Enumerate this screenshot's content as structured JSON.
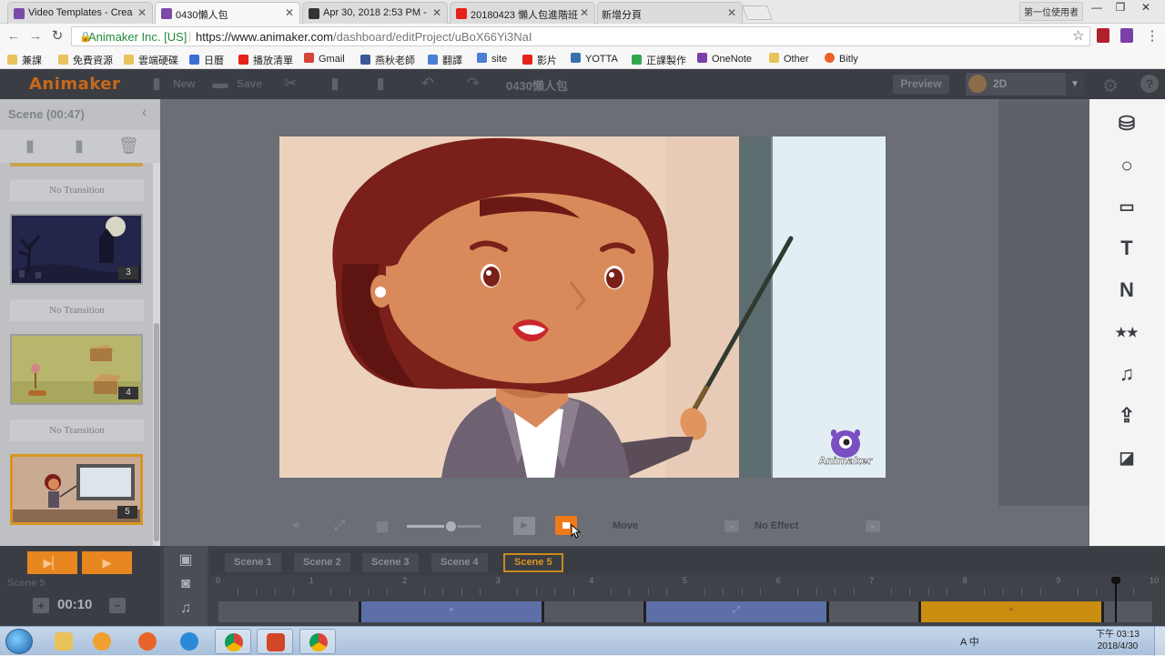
{
  "browser": {
    "tabs": [
      {
        "title": "Video Templates - Crea",
        "icon_color": "#7a4aa8"
      },
      {
        "title": "0430懶人包",
        "icon_color": "#7a4aa8"
      },
      {
        "title": "Apr 30, 2018 2:53 PM -",
        "icon_color": "#333333"
      },
      {
        "title": "20180423 懶人包進階班",
        "icon_color": "#e62117"
      },
      {
        "title": "新增分頁",
        "icon_color": "#cccccc"
      }
    ],
    "user_badge": "第一位使用者",
    "window_buttons": [
      "—",
      "❐",
      "✕"
    ],
    "address": {
      "secure_label": "Animaker Inc. [US]",
      "separator": "|",
      "url_host": "https://www.animaker.com",
      "url_path": "/dashboard/editProject/uBoX66Yi3NaI"
    },
    "bookmarks": [
      {
        "label": "兼課",
        "color": "#e8c35a"
      },
      {
        "label": "免費資源",
        "color": "#e8c35a"
      },
      {
        "label": "雲端硬碟",
        "color": "#e8c35a"
      },
      {
        "label": "日曆",
        "color": "#3b6fd6"
      },
      {
        "label": "播放清單",
        "color": "#e62117"
      },
      {
        "label": "Gmail",
        "color": "#d44638"
      },
      {
        "label": "燕秋老師",
        "color": "#3b5998"
      },
      {
        "label": "翻譯",
        "color": "#4a7fd4"
      },
      {
        "label": "site",
        "color": "#4a7fd4"
      },
      {
        "label": "影片",
        "color": "#e62117"
      },
      {
        "label": "YOTTA",
        "color": "#3a6fb0"
      },
      {
        "label": "正課製作",
        "color": "#2fa84f"
      },
      {
        "label": "OneNote",
        "color": "#7a3fa8"
      },
      {
        "label": "Other",
        "color": "#e8c35a"
      },
      {
        "label": "Bitly",
        "color": "#ee6123"
      }
    ]
  },
  "app": {
    "logo": "Animaker",
    "toolbar": {
      "new_label": "New",
      "save_label": "Save",
      "project_title": "0430懶人包",
      "preview_label": "Preview",
      "mode_label": "2D"
    },
    "scene_panel": {
      "title": "Scene  (00:47)",
      "transition_label": "No Transition",
      "scenes": [
        {
          "number": "3"
        },
        {
          "number": "4"
        },
        {
          "number": "5"
        }
      ]
    },
    "stage_controls": {
      "zoom_level": 0.6,
      "animation_label": "Move",
      "effect_label": "No Effect"
    },
    "watermark": "Animaker",
    "timeline": {
      "scene_label": "Scene 5",
      "duration": "00:10",
      "tabs": [
        "Scene 1",
        "Scene 2",
        "Scene 3",
        "Scene 4",
        "Scene 5"
      ],
      "active_tab": "Scene 5",
      "ticks": [
        "0",
        "1",
        "2",
        "3",
        "4",
        "5",
        "6",
        "7",
        "8",
        "9",
        "10"
      ],
      "playhead_seconds": 9.6
    }
  },
  "taskbar": {
    "clock_time": "下午 03:13",
    "clock_date": "2018/4/30",
    "tray_text": "A 中"
  },
  "colors": {
    "accent_orange": "#ef7a1a",
    "scene_selected": "#d99521",
    "track_blue": "#5d6fa7",
    "track_gold": "#c98d10"
  }
}
